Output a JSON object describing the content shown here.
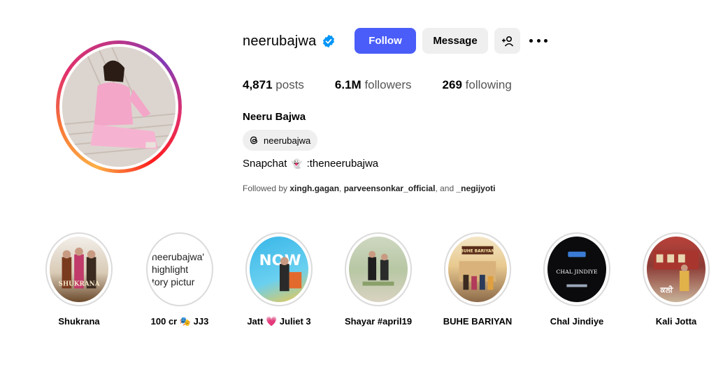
{
  "profile": {
    "username": "neerubajwa",
    "verified": true,
    "full_name": "Neeru Bajwa",
    "threads_handle": "neerubajwa",
    "bio_prefix": "Snapchat",
    "bio_handle": ":theneerubajwa",
    "followed_by_prefix": "Followed by ",
    "followed_by_1": "xingh.gagan",
    "followed_by_sep1": ", ",
    "followed_by_2": "parveensonkar_official",
    "followed_by_sep2": ", and ",
    "followed_by_3": "_negijyoti"
  },
  "buttons": {
    "follow": "Follow",
    "message": "Message",
    "add_user_glyph": "+"
  },
  "stats": {
    "posts_count": "4,871",
    "posts_label": "posts",
    "followers_count": "6.1M",
    "followers_label": "followers",
    "following_count": "269",
    "following_label": "following"
  },
  "highlights": [
    {
      "label": "Shukrana",
      "cover_text": "SHUKRANA"
    },
    {
      "label": "100 cr 🎭 JJ3",
      "cover_lines": [
        "neerubajwa'",
        "highlight",
        "tory pictur"
      ]
    },
    {
      "label": "Jatt 💗 Juliet 3",
      "cover_text": "NOW"
    },
    {
      "label": "Shayar #april19",
      "cover_text": ""
    },
    {
      "label": "BUHE BARIYAN",
      "cover_text": "BUHE BARIYAN"
    },
    {
      "label": "Chal Jindiye",
      "cover_text": "CHAL JINDIYE"
    },
    {
      "label": "Kali Jotta",
      "cover_text": "ਕਲੀ"
    }
  ],
  "colors": {
    "accent": "#4a5df9",
    "verified": "#0095f6",
    "button_gray": "#efefef"
  }
}
